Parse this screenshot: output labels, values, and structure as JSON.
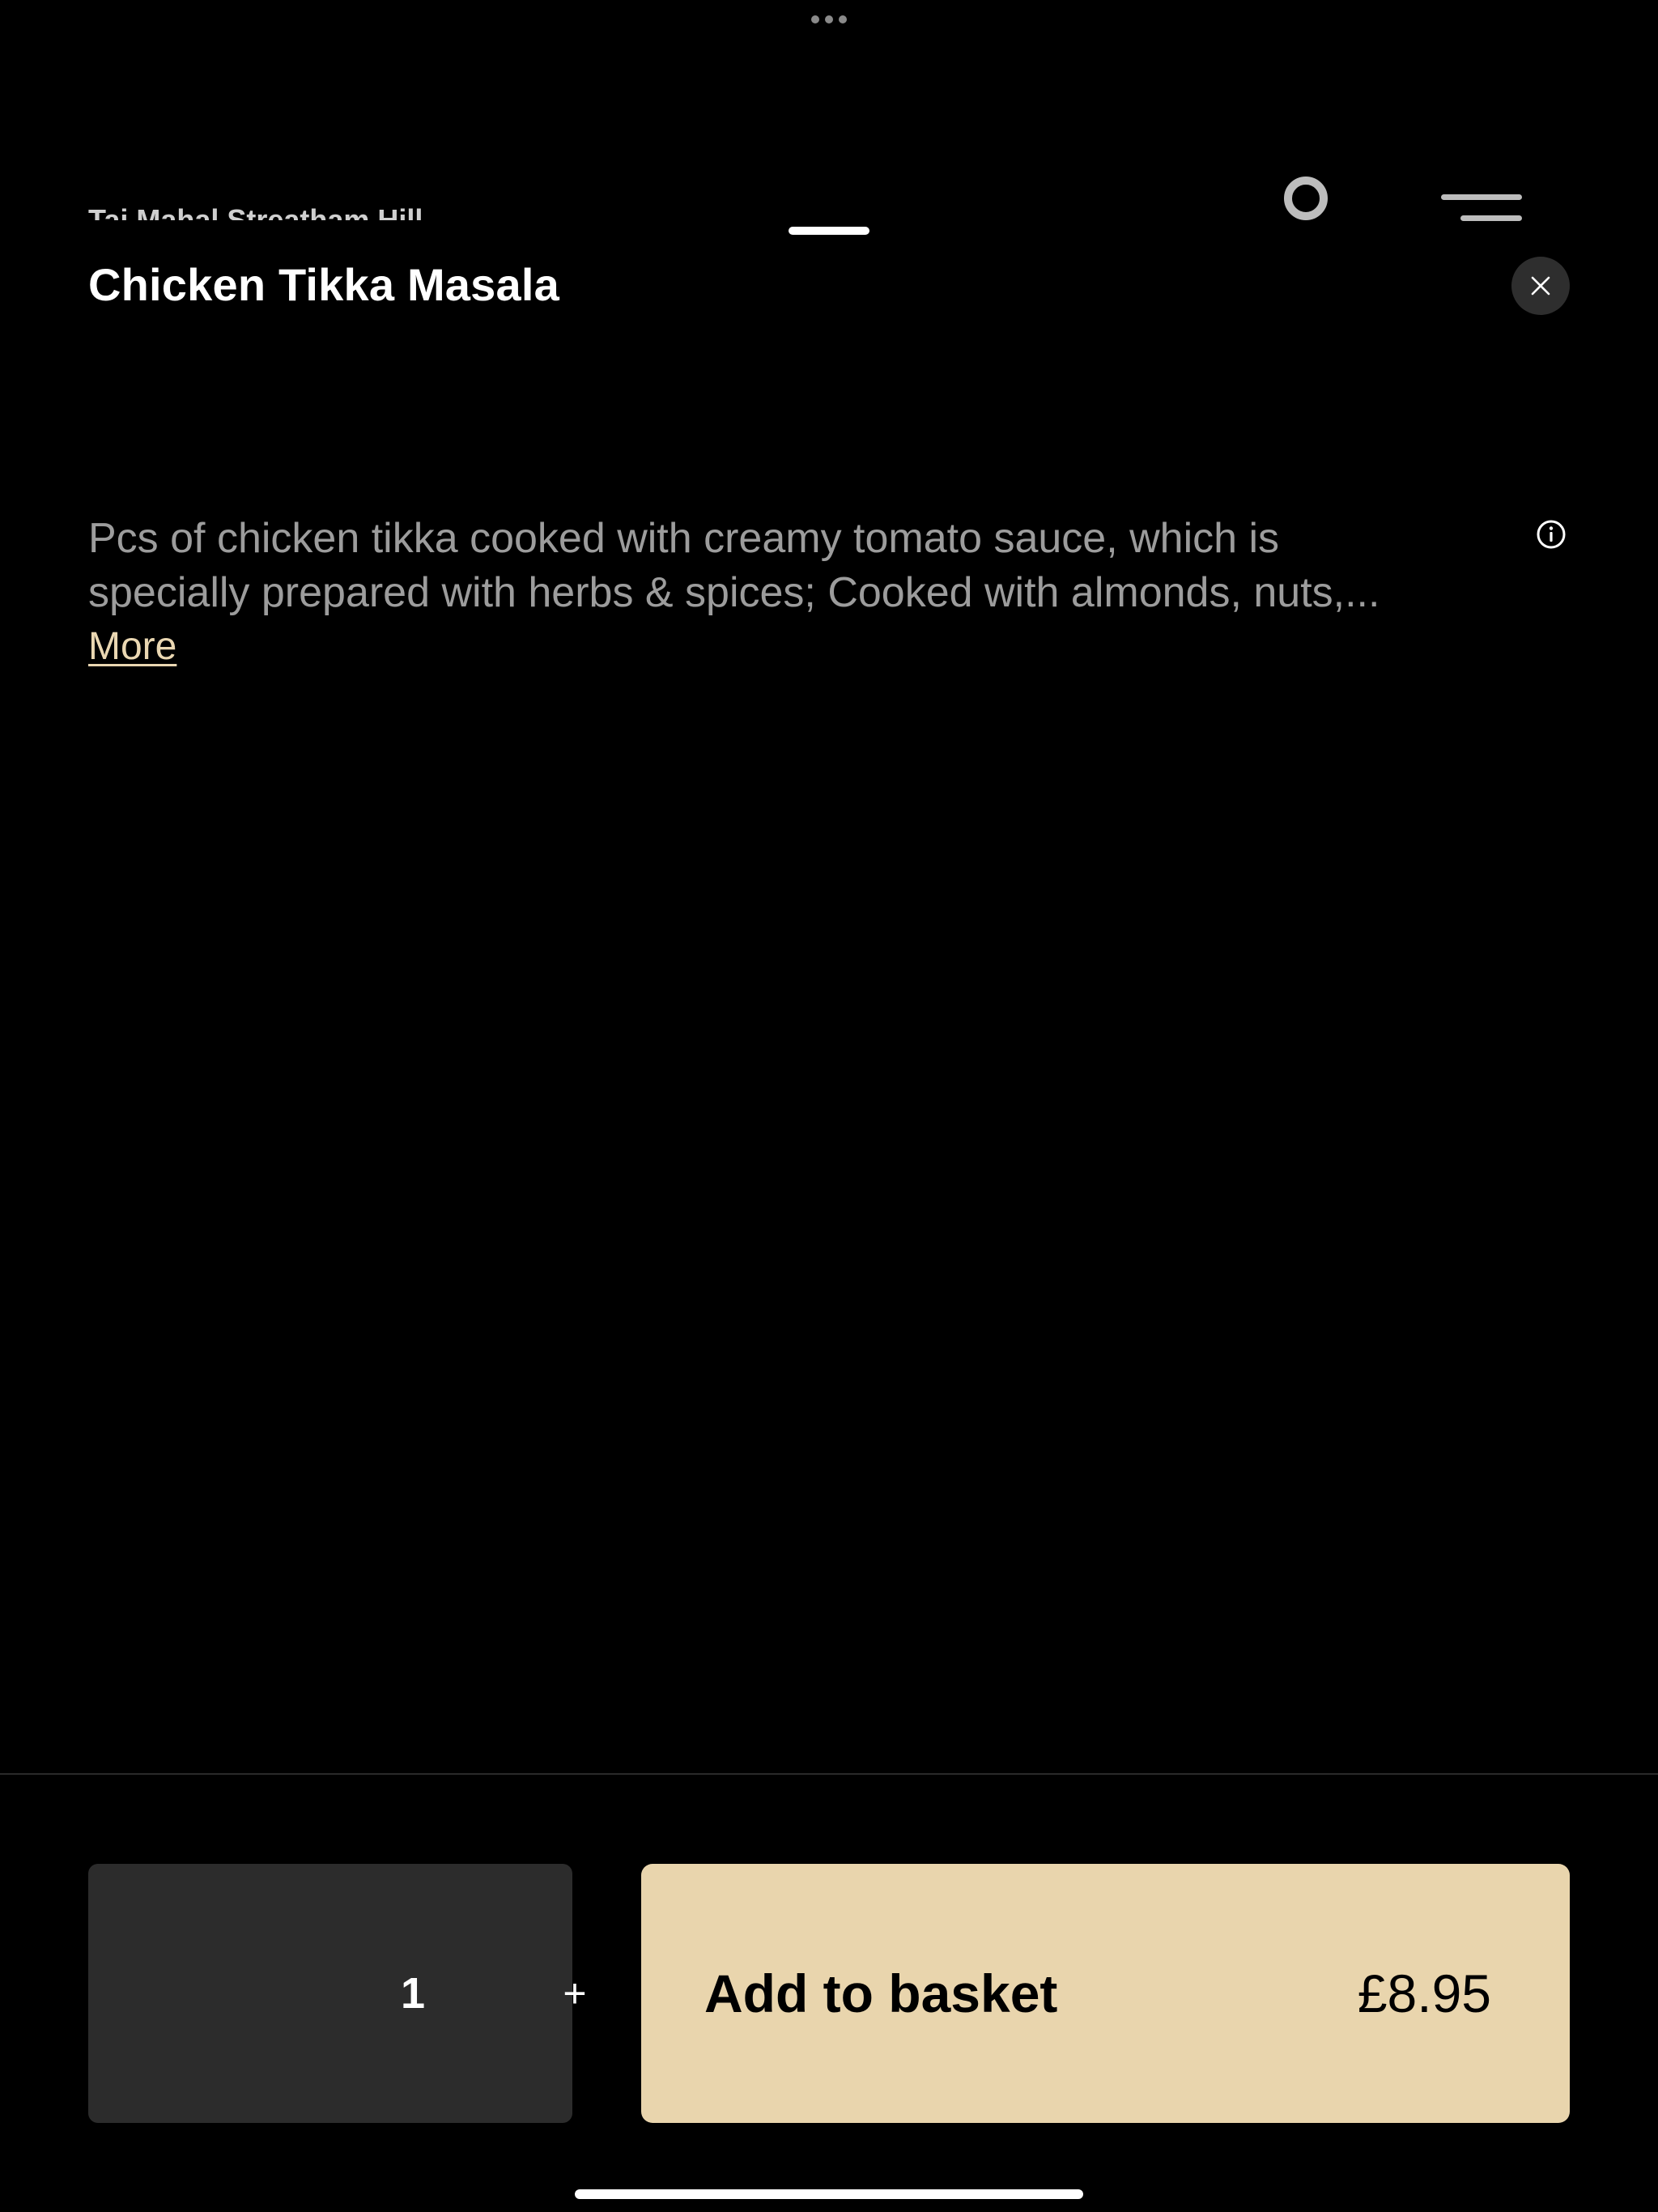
{
  "background": {
    "restaurant_name": "Taj Mahal Streatham Hill"
  },
  "item": {
    "title": "Chicken Tikka Masala",
    "description_line1": "Pcs of chicken tikka cooked with creamy tomato sauce, which is",
    "description_line2": "specially prepared with herbs & spices; Cooked with almonds, nuts,...",
    "more_label": "More"
  },
  "order": {
    "quantity": "1",
    "plus_label": "+",
    "add_label": "Add to basket",
    "price": "£8.95"
  },
  "icons": {
    "close": "close-icon",
    "info": "info-icon",
    "search": "search-icon",
    "menu": "menu-icon"
  },
  "colors": {
    "background": "#000000",
    "accent": "#e9d5ad",
    "link": "#ead7b2",
    "stepper": "#2c2c2c",
    "close_button": "#2e2e2e",
    "description_text": "#9c9c9c"
  }
}
